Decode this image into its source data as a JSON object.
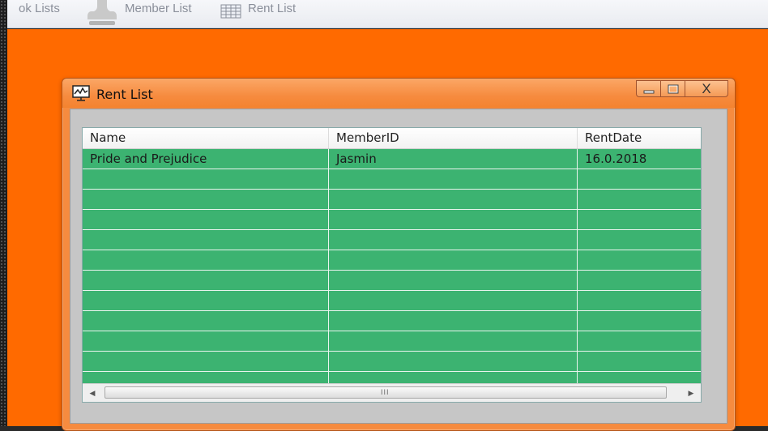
{
  "toolbar": {
    "book_lists_label": "ok Lists",
    "member_list_label": "Member List",
    "rent_list_label": "Rent List"
  },
  "window": {
    "title": "Rent List",
    "icon": "chart-monitor-icon",
    "buttons": {
      "minimize": "minimize-icon",
      "maximize": "maximize-icon",
      "close_glyph": "X"
    }
  },
  "grid": {
    "columns": [
      "Name",
      "MemberID",
      "RentDate"
    ],
    "rows": [
      {
        "name": "Pride and Prejudice",
        "member_id": "Jasmin",
        "rent_date": "16.0.2018"
      },
      {
        "name": "",
        "member_id": "",
        "rent_date": ""
      },
      {
        "name": "",
        "member_id": "",
        "rent_date": ""
      },
      {
        "name": "",
        "member_id": "",
        "rent_date": ""
      },
      {
        "name": "",
        "member_id": "",
        "rent_date": ""
      },
      {
        "name": "",
        "member_id": "",
        "rent_date": ""
      },
      {
        "name": "",
        "member_id": "",
        "rent_date": ""
      },
      {
        "name": "",
        "member_id": "",
        "rent_date": ""
      },
      {
        "name": "",
        "member_id": "",
        "rent_date": ""
      },
      {
        "name": "",
        "member_id": "",
        "rent_date": ""
      },
      {
        "name": "",
        "member_id": "",
        "rent_date": ""
      },
      {
        "name": "",
        "member_id": "",
        "rent_date": ""
      }
    ],
    "scroll_grip": "III"
  },
  "colors": {
    "desktop": "#ff6a00",
    "row_fill": "#3cb371",
    "window_frame": "#f68b3f"
  }
}
